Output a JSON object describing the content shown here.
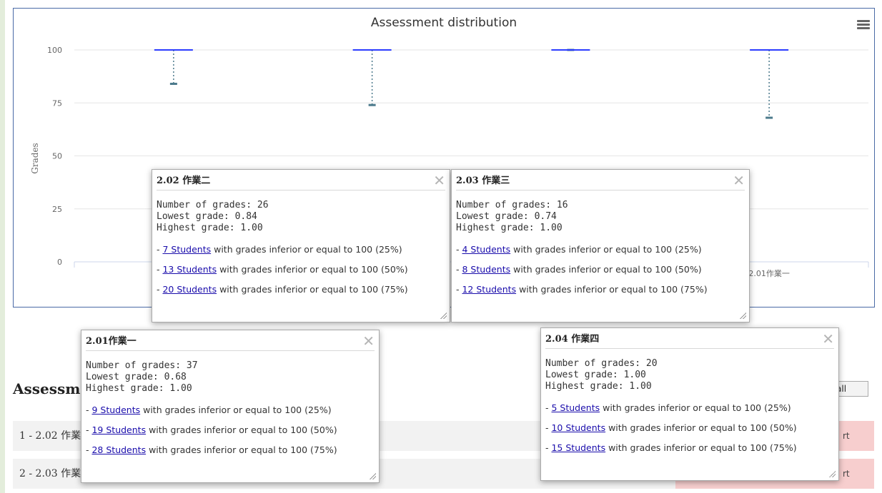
{
  "chart": {
    "title": "Assessment distribution",
    "ylabel": "Grades",
    "category_labels": [
      "2.",
      "",
      "",
      "2.01作業一"
    ],
    "y_ticks": [
      "0",
      "25",
      "50",
      "75",
      "100"
    ]
  },
  "chart_data": {
    "type": "boxplot",
    "title": "Assessment distribution",
    "ylabel": "Grades",
    "ylim": [
      0,
      100
    ],
    "y_ticks": [
      0,
      25,
      50,
      75,
      100
    ],
    "series": [
      {
        "min": 84,
        "q1": 100,
        "median": 100,
        "q3": 100,
        "max": 100
      },
      {
        "min": 74,
        "q1": 100,
        "median": 100,
        "q3": 100,
        "max": 100
      },
      {
        "min": 100,
        "q1": 100,
        "median": 100,
        "q3": 100,
        "max": 100
      },
      {
        "min": 68,
        "q1": 100,
        "median": 100,
        "q3": 100,
        "max": 100
      }
    ],
    "grid": true
  },
  "popups": [
    {
      "title": "2.02 作業二",
      "stats": [
        "Number of grades: 26",
        "Lowest grade: 0.84",
        "Highest grade: 1.00"
      ],
      "links": [
        {
          "prefix": "- ",
          "link": "7 Students",
          "suffix": " with grades inferior or equal to 100 (25%)"
        },
        {
          "prefix": "- ",
          "link": "13 Students",
          "suffix": " with grades inferior or equal to 100 (50%)"
        },
        {
          "prefix": "- ",
          "link": "20 Students",
          "suffix": " with grades inferior or equal to 100 (75%)"
        }
      ]
    },
    {
      "title": "2.03 作業三",
      "stats": [
        "Number of grades: 16",
        "Lowest grade: 0.74",
        "Highest grade: 1.00"
      ],
      "links": [
        {
          "prefix": "- ",
          "link": "4 Students",
          "suffix": " with grades inferior or equal to 100 (25%)"
        },
        {
          "prefix": "- ",
          "link": "8 Students",
          "suffix": " with grades inferior or equal to 100 (50%)"
        },
        {
          "prefix": "- ",
          "link": "12 Students",
          "suffix": " with grades inferior or equal to 100 (75%)"
        }
      ]
    },
    {
      "title": "2.01作業一",
      "stats": [
        "Number of grades: 37",
        "Lowest grade: 0.68",
        "Highest grade: 1.00"
      ],
      "links": [
        {
          "prefix": "- ",
          "link": "9 Students",
          "suffix": " with grades inferior or equal to 100 (25%)"
        },
        {
          "prefix": "- ",
          "link": "19 Students",
          "suffix": " with grades inferior or equal to 100 (50%)"
        },
        {
          "prefix": "- ",
          "link": "28 Students",
          "suffix": " with grades inferior or equal to 100 (75%)"
        }
      ]
    },
    {
      "title": "2.04 作業四",
      "stats": [
        "Number of grades: 20",
        "Lowest grade: 1.00",
        "Highest grade: 1.00"
      ],
      "links": [
        {
          "prefix": "- ",
          "link": "5 Students",
          "suffix": " with grades inferior or equal to 100 (25%)"
        },
        {
          "prefix": "- ",
          "link": "10 Students",
          "suffix": " with grades inferior or equal to 100 (50%)"
        },
        {
          "prefix": "- ",
          "link": "15 Students",
          "suffix": " with grades inferior or equal to 100 (75%)"
        }
      ]
    }
  ],
  "section": {
    "title": "Assessm",
    "all_button": "all",
    "rows": [
      {
        "label": "1 - 2.02 作業",
        "status": "rt"
      },
      {
        "label": "2 - 2.03 作業",
        "status": "rt"
      }
    ]
  },
  "colors": {
    "box_line": "#2b3cff",
    "whisker": "#4c7a8c",
    "status_bg": "#f7cece",
    "page_bg": "#e3eddb"
  }
}
